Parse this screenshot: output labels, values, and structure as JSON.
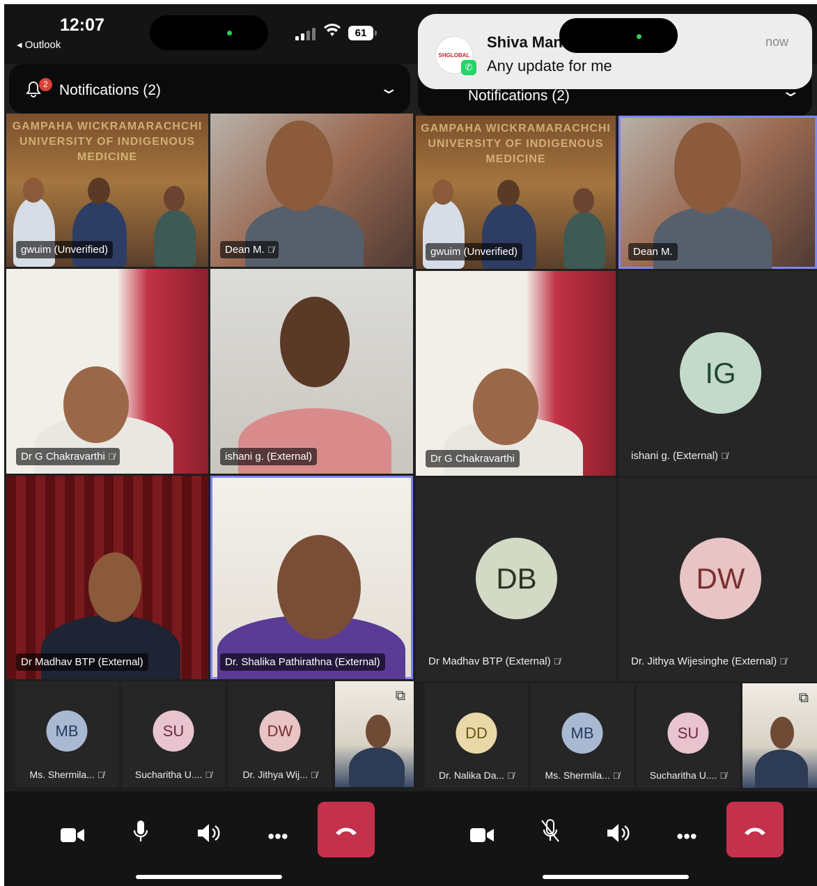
{
  "status_bar": {
    "time": "12:07",
    "back_app": "◂ Outlook",
    "battery": "61"
  },
  "notifications": {
    "label": "Notifications (2)",
    "count": "2"
  },
  "left": {
    "room_sign": "GAMPAHA WICKRAMARACHCHI\nUNIVERSITY OF INDIGENOUS MEDICINE",
    "tiles": [
      {
        "name": "gwuim (Unverified)",
        "muted": false
      },
      {
        "name": "Dean M.",
        "muted": true
      },
      {
        "name": "Dr G Chakravarthi",
        "muted": true
      },
      {
        "name": "ishani g. (External)",
        "muted": false
      },
      {
        "name": "Dr Madhav BTP (External)",
        "muted": false
      },
      {
        "name": "Dr. Shalika Pathirathna (External)",
        "muted": false
      }
    ],
    "strip": [
      {
        "initials": "MB",
        "name": "Ms. Shermila...",
        "bg": "#a9b9d1",
        "fg": "#243a5e"
      },
      {
        "initials": "SU",
        "name": "Sucharitha U....",
        "bg": "#e8c4cf",
        "fg": "#6e2a3e"
      },
      {
        "initials": "DW",
        "name": "Dr. Jithya Wij...",
        "bg": "#e8c4c4",
        "fg": "#7a2e2e"
      }
    ]
  },
  "right": {
    "banner": {
      "sender": "Shiva Man",
      "message": "Any update for me",
      "when": "now",
      "logo_text": "SHGLOBAL"
    },
    "tiles": [
      {
        "name": "gwuim (Unverified)",
        "muted": false
      },
      {
        "name": "Dean M.",
        "muted": false
      },
      {
        "name": "Dr G Chakravarthi",
        "muted": false
      },
      {
        "name": "ishani g. (External)",
        "muted": true,
        "initials": "IG",
        "bg": "#c3d9c9",
        "fg": "#1f4a33"
      },
      {
        "name": "Dr Madhav BTP (External)",
        "muted": true,
        "initials": "DB",
        "bg": "#d2d9c5",
        "fg": "#2b3520"
      },
      {
        "name": "Dr. Jithya Wijesinghe (External)",
        "muted": true,
        "initials": "DW",
        "bg": "#e8c4c4",
        "fg": "#7a2e2e"
      }
    ],
    "strip": [
      {
        "initials": "DD",
        "name": "Dr. Nalika Da...",
        "bg": "#ead9a8",
        "fg": "#6b5416"
      },
      {
        "initials": "MB",
        "name": "Ms. Shermila...",
        "bg": "#a9b9d1",
        "fg": "#243a5e"
      },
      {
        "initials": "SU",
        "name": "Sucharitha U....",
        "bg": "#e8c4cf",
        "fg": "#6e2a3e"
      }
    ]
  },
  "icons": {
    "mute": "mic-off-icon",
    "camera": "camera-icon",
    "mic": "mic-icon",
    "speaker": "speaker-icon",
    "more": "more-icon",
    "hangup": "hangup-icon"
  },
  "colors": {
    "speaking_outline": "#7f85f5",
    "hangup": "#c4314b",
    "badge": "#d9423a"
  }
}
